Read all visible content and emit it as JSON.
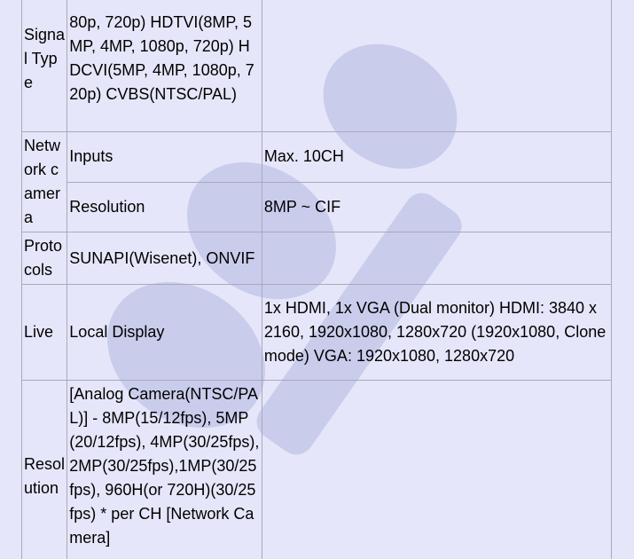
{
  "rows": {
    "signal_type": {
      "label": "Signal Type",
      "value": "80p, 720p)\nHDTVI(8MP, 5MP, 4MP, 1080p, 720p)\nHDCVI(5MP, 4MP, 1080p, 720p)\nCVBS(NTSC/PAL)"
    },
    "network_camera": {
      "label": "Network camera",
      "inputs_label": "Inputs",
      "inputs_value": "Max. 10CH",
      "resolution_label": "Resolution",
      "resolution_value": "8MP ~ CIF"
    },
    "protocols": {
      "label": "Protocols",
      "value": "SUNAPI(Wisenet), ONVIF"
    },
    "live": {
      "label": "Live",
      "sub_label": "Local Display",
      "value": "1x HDMI, 1x VGA (Dual monitor)\nHDMI: 3840 x 2160, 1920x1080, 1280x720 (1920x1080, Clone mode)\nVGA: 1920x1080, 1280x720"
    },
    "resolution": {
      "label": "Resolution",
      "value": "[Analog Camera(NTSC/PAL)]\n- 8MP(15/12fps), 5MP(20/12fps), 4MP(30/25fps), 2MP(30/25fps),1MP(30/25fps), 960H(or 720H)(30/25fps) * per CH\n[Network Camera]"
    }
  },
  "colors": {
    "background": "#e6e6fa",
    "border": "#a9a9b8"
  }
}
